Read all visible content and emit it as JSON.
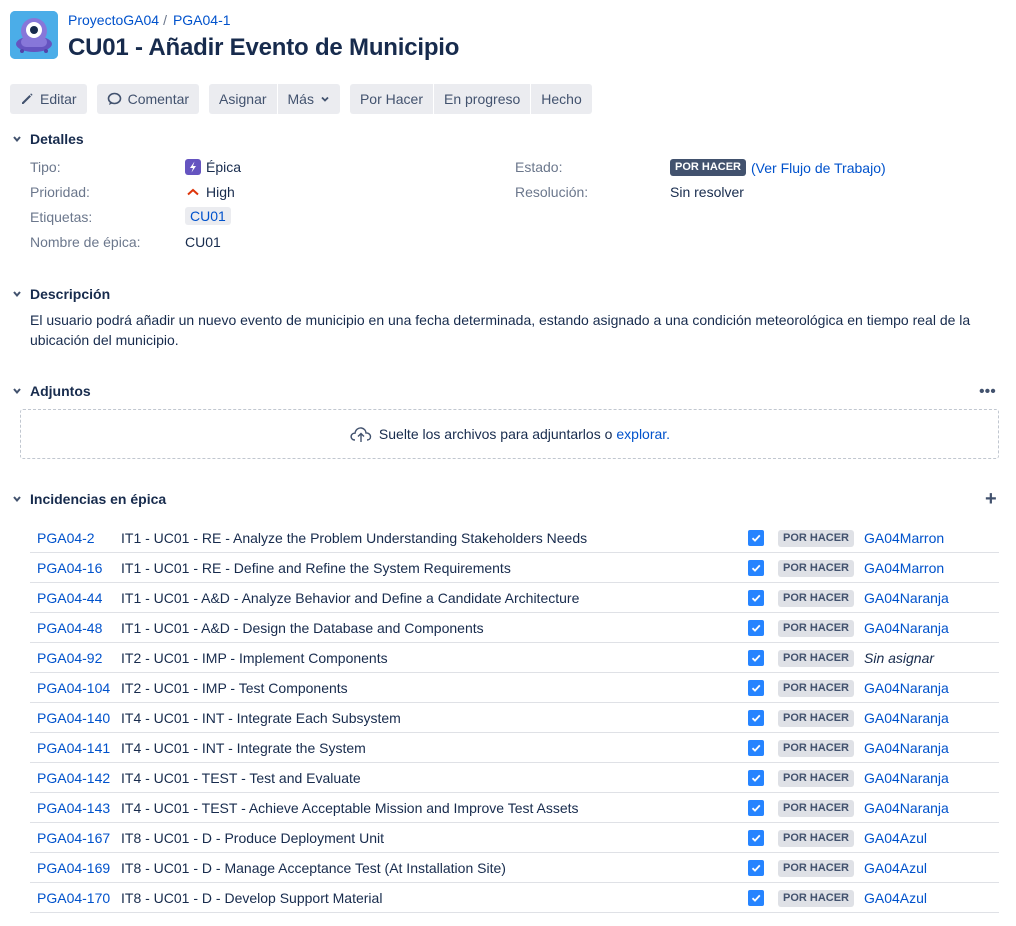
{
  "breadcrumb": {
    "project": "ProyectoGA04",
    "separator": "/",
    "parent": "PGA04-1"
  },
  "title": "CU01 - Añadir Evento de Municipio",
  "toolbar": {
    "edit": "Editar",
    "comment": "Comentar",
    "assign": "Asignar",
    "more": "Más",
    "todo": "Por Hacer",
    "in_progress": "En progreso",
    "done": "Hecho"
  },
  "details": {
    "heading": "Detalles",
    "type_label": "Tipo:",
    "type_value": "Épica",
    "priority_label": "Prioridad:",
    "priority_value": "High",
    "labels_label": "Etiquetas:",
    "labels_value": "CU01",
    "epic_name_label": "Nombre de épica:",
    "epic_name_value": "CU01",
    "status_label": "Estado:",
    "status_value": "POR HACER",
    "workflow_link": "(Ver Flujo de Trabajo)",
    "resolution_label": "Resolución:",
    "resolution_value": "Sin resolver"
  },
  "description": {
    "heading": "Descripción",
    "text": "El usuario podrá añadir un nuevo evento de municipio en una fecha determinada, estando asignado a una condición meteorológica en tiempo real de la ubicación del municipio."
  },
  "attachments": {
    "heading": "Adjuntos",
    "more": "•••",
    "drop_text": "Suelte los archivos para adjuntarlos o",
    "browse_link": "explorar."
  },
  "epic_issues": {
    "heading": "Incidencias en épica",
    "add": "+",
    "rows": [
      {
        "key": "PGA04-2",
        "summary": "IT1 - UC01 - RE - Analyze the Problem Understanding Stakeholders Needs",
        "status": "POR HACER",
        "assignee": "GA04Marron"
      },
      {
        "key": "PGA04-16",
        "summary": "IT1 - UC01 - RE - Define and Refine the System Requirements",
        "status": "POR HACER",
        "assignee": "GA04Marron"
      },
      {
        "key": "PGA04-44",
        "summary": "IT1 - UC01 - A&D - Analyze Behavior and Define a Candidate Architecture",
        "status": "POR HACER",
        "assignee": "GA04Naranja"
      },
      {
        "key": "PGA04-48",
        "summary": "IT1 - UC01 - A&D - Design the Database and Components",
        "status": "POR HACER",
        "assignee": "GA04Naranja"
      },
      {
        "key": "PGA04-92",
        "summary": "IT2 - UC01 - IMP - Implement Components",
        "status": "POR HACER",
        "assignee": "Sin asignar"
      },
      {
        "key": "PGA04-104",
        "summary": "IT2 - UC01 - IMP - Test Components",
        "status": "POR HACER",
        "assignee": "GA04Naranja"
      },
      {
        "key": "PGA04-140",
        "summary": "IT4 - UC01 - INT - Integrate Each Subsystem",
        "status": "POR HACER",
        "assignee": "GA04Naranja"
      },
      {
        "key": "PGA04-141",
        "summary": "IT4 - UC01 - INT - Integrate the System",
        "status": "POR HACER",
        "assignee": "GA04Naranja"
      },
      {
        "key": "PGA04-142",
        "summary": "IT4 - UC01 - TEST - Test and Evaluate",
        "status": "POR HACER",
        "assignee": "GA04Naranja"
      },
      {
        "key": "PGA04-143",
        "summary": "IT4 - UC01 - TEST - Achieve Acceptable Mission and Improve Test Assets",
        "status": "POR HACER",
        "assignee": "GA04Naranja"
      },
      {
        "key": "PGA04-167",
        "summary": "IT8 - UC01 - D - Produce Deployment Unit",
        "status": "POR HACER",
        "assignee": "GA04Azul"
      },
      {
        "key": "PGA04-169",
        "summary": "IT8 - UC01 - D - Manage Acceptance Test (At Installation Site)",
        "status": "POR HACER",
        "assignee": "GA04Azul"
      },
      {
        "key": "PGA04-170",
        "summary": "IT8 - UC01 - D - Develop Support Material",
        "status": "POR HACER",
        "assignee": "GA04Azul"
      }
    ]
  },
  "colors": {
    "link": "#0052cc",
    "text": "#172b4d",
    "muted": "#6b778c",
    "button_bg": "#ebecf0",
    "epic_purple": "#6554c0",
    "priority_high": "#de350b",
    "checkbox_blue": "#2684ff"
  }
}
